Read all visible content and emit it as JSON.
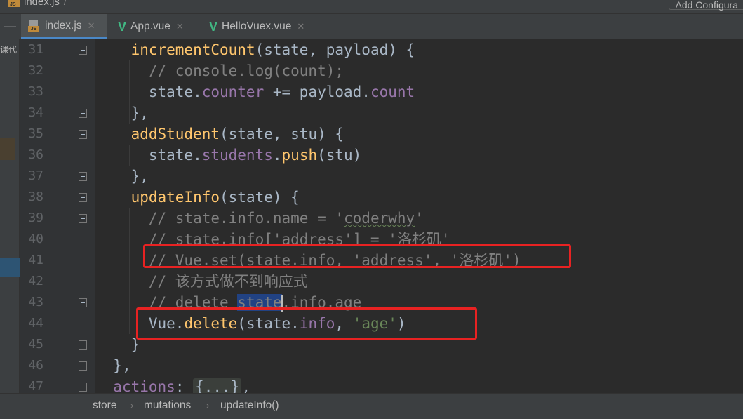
{
  "top_bar": {
    "file_name": "index.js",
    "add_config_label": "Add Configura"
  },
  "tabs": [
    {
      "label": "index.js",
      "icon": "js-file-icon",
      "active": true
    },
    {
      "label": "App.vue",
      "icon": "vue-file-icon",
      "active": false
    },
    {
      "label": "HelloVuex.vue",
      "icon": "vue-file-icon",
      "active": false
    }
  ],
  "left_panel_label": "课代",
  "editor": {
    "line_numbers": [
      "31",
      "32",
      "33",
      "34",
      "35",
      "36",
      "37",
      "38",
      "39",
      "40",
      "41",
      "42",
      "43",
      "44",
      "45",
      "46",
      "47"
    ],
    "lines": [
      {
        "indent": "    ",
        "text": "incrementCount(state, payload) {"
      },
      {
        "indent": "      ",
        "text": "// console.log(count);"
      },
      {
        "indent": "      ",
        "text": "state.counter += payload.count"
      },
      {
        "indent": "    ",
        "text": "},"
      },
      {
        "indent": "    ",
        "text": "addStudent(state, stu) {"
      },
      {
        "indent": "      ",
        "text": "state.students.push(stu)"
      },
      {
        "indent": "    ",
        "text": "},"
      },
      {
        "indent": "    ",
        "text": "updateInfo(state) {"
      },
      {
        "indent": "      ",
        "text": "// state.info.name = 'coderwhy'"
      },
      {
        "indent": "      ",
        "text": "// state.info['address'] = '洛杉矶'"
      },
      {
        "indent": "      ",
        "text": "// Vue.set(state.info, 'address', '洛杉矶')"
      },
      {
        "indent": "      ",
        "text": "// 该方式做不到响应式"
      },
      {
        "indent": "      ",
        "text": "// delete state.info.age"
      },
      {
        "indent": "      ",
        "text": "Vue.delete(state.info, 'age')"
      },
      {
        "indent": "    ",
        "text": "}"
      },
      {
        "indent": "  ",
        "text": "},"
      },
      {
        "indent": "  ",
        "text": "actions: {...},"
      }
    ]
  },
  "breadcrumb": [
    "store",
    "mutations",
    "updateInfo()"
  ],
  "colors": {
    "editor_bg": "#2b2b2b",
    "function": "#ffc66d",
    "property": "#9876aa",
    "string": "#6a8759",
    "comment": "#808080",
    "keyword": "#cc7832",
    "highlight_box": "#e82222"
  }
}
